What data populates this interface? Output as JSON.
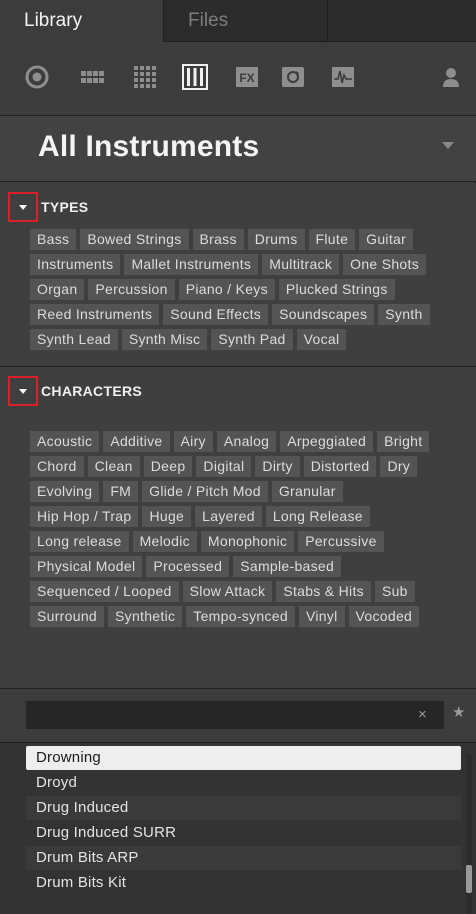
{
  "tabs": [
    {
      "label": "Library",
      "active": true
    },
    {
      "label": "Files",
      "active": false
    }
  ],
  "toolbar": {
    "icons": [
      "preset-icon",
      "group-icon",
      "sound-icon",
      "instrument-icon",
      "effect-icon",
      "loop-icon",
      "one-shot-icon",
      "user-icon"
    ],
    "fx_label": "FX",
    "selected": "instrument-icon"
  },
  "header": {
    "title": "All Instruments"
  },
  "types": {
    "title": "TYPES",
    "tags": [
      "Bass",
      "Bowed Strings",
      "Brass",
      "Drums",
      "Flute",
      "Guitar",
      "Instruments",
      "Mallet Instruments",
      "Multitrack",
      "One Shots",
      "Organ",
      "Percussion",
      "Piano / Keys",
      "Plucked Strings",
      "Reed Instruments",
      "Sound Effects",
      "Soundscapes",
      "Synth",
      "Synth Lead",
      "Synth Misc",
      "Synth Pad",
      "Vocal"
    ]
  },
  "characters": {
    "title": "CHARACTERS",
    "tags": [
      "Acoustic",
      "Additive",
      "Airy",
      "Analog",
      "Arpeggiated",
      "Bright",
      "Chord",
      "Clean",
      "Deep",
      "Digital",
      "Dirty",
      "Distorted",
      "Dry",
      "Evolving",
      "FM",
      "Glide / Pitch Mod",
      "Granular",
      "Hip Hop / Trap",
      "Huge",
      "Layered",
      "Long Release",
      "Long release",
      "Melodic",
      "Monophonic",
      "Percussive",
      "Physical Model",
      "Processed",
      "Sample-based",
      "Sequenced / Looped",
      "Slow Attack",
      "Stabs & Hits",
      "Sub",
      "Surround",
      "Synthetic",
      "Tempo-synced",
      "Vinyl",
      "Vocoded"
    ]
  },
  "search": {
    "value": "",
    "placeholder": "",
    "clear_glyph": "×",
    "star_glyph": "★"
  },
  "results": [
    {
      "label": "Drowning",
      "selected": true
    },
    {
      "label": "Droyd",
      "selected": false
    },
    {
      "label": "Drug Induced",
      "selected": false
    },
    {
      "label": "Drug Induced SURR",
      "selected": false
    },
    {
      "label": "Drum Bits ARP",
      "selected": false
    },
    {
      "label": "Drum Bits Kit",
      "selected": false
    }
  ],
  "colors": {
    "highlight_outline": "#d8202b",
    "tag_bg": "#545454",
    "panel_bg": "#3f3f3f"
  }
}
